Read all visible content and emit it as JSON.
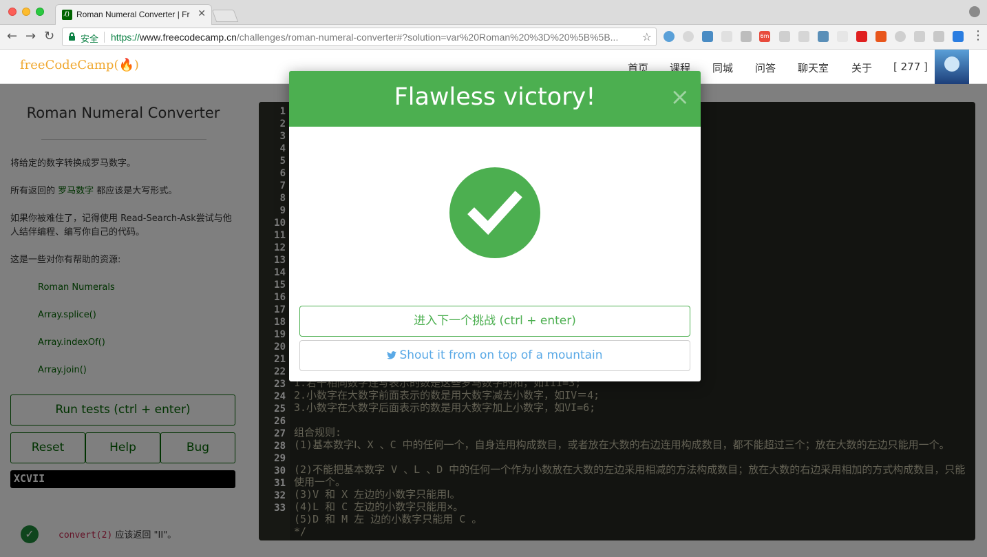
{
  "browser": {
    "tab_title": "Roman Numeral Converter | Fr",
    "secure_label": "安全",
    "url_scheme": "https://",
    "url_host": "www.freecodecamp.cn",
    "url_path": "/challenges/roman-numeral-converter#?solution=var%20Roman%20%3D%20%5B%5B...",
    "extension_badge": "6m"
  },
  "header": {
    "logo": "freeCodeCamp(🔥)",
    "nav": [
      "首页",
      "课程",
      "同城",
      "问答",
      "聊天室",
      "关于",
      "[ 277 ]"
    ]
  },
  "challenge": {
    "title": "Roman Numeral Converter",
    "desc1": "将给定的数字转换成罗马数字。",
    "desc2_pre": "所有返回的 ",
    "desc2_link": "罗马数字",
    "desc2_post": " 都应该是大写形式。",
    "desc3": "如果你被难住了，记得使用 Read-Search-Ask尝试与他人结伴编程、编写你自己的代码。",
    "desc4": "这是一些对你有帮助的资源:",
    "resources": [
      "Roman Numerals",
      "Array.splice()",
      "Array.indexOf()",
      "Array.join()"
    ],
    "run_tests": "Run tests (ctrl + enter)",
    "reset": "Reset",
    "help": "Help",
    "bug": "Bug",
    "output": "XCVII",
    "test_code": "convert(2)",
    "test_text": " 应该返回 \"II\"。"
  },
  "editor": {
    "line_numbers": [
      "1",
      "2",
      "3",
      "4",
      "5",
      "6",
      "7",
      "8",
      "9",
      "10",
      "11",
      "12",
      "13",
      "14",
      "15",
      "16",
      "17",
      "18",
      "19",
      "20",
      "21",
      "22",
      "23",
      "24",
      "25",
      "26",
      "27",
      "28",
      "29",
      "30",
      "31",
      "32",
      "33"
    ],
    "line23": "1.若干相同数字连写表示的数是这些罗马数字的和，如III=3;",
    "line24": "2.小数字在大数字前面表示的数是用大数字减去小数字，如IV＝4;",
    "line25": "3.小数字在大数字后面表示的数是用大数字加上小数字，如VI=6;",
    "line27": "组合规则:",
    "line28": "(1)基本数字Ⅰ、X 、C 中的任何一个，自身连用构成数目，或者放在大数的右边连用构成数目，都不能超过三个；放在大数的左边只能用一个。",
    "line29": "(2)不能把基本数字 V 、L 、D 中的任何一个作为小数放在大数的左边采用相减的方法构成数目；放在大数的右边采用相加的方式构成数目，只能使用一个。",
    "line30": "(3)V 和 X 左边的小数字只能用Ⅰ。",
    "line31": "(4)L 和 C 左边的小数字只能用×。",
    "line32": "(5)D 和 M 左 边的小数字只能用 C 。",
    "line33": "*/"
  },
  "modal": {
    "title": "Flawless victory!",
    "close": "×",
    "next_button": "进入下一个挑战 (ctrl + enter)",
    "tweet_button": "Shout it from on top of a mountain"
  },
  "colors": {
    "success_green": "#4caf50",
    "fcc_green": "#006400",
    "editor_bg": "#272822",
    "twitter_blue": "#5aa9e6"
  }
}
